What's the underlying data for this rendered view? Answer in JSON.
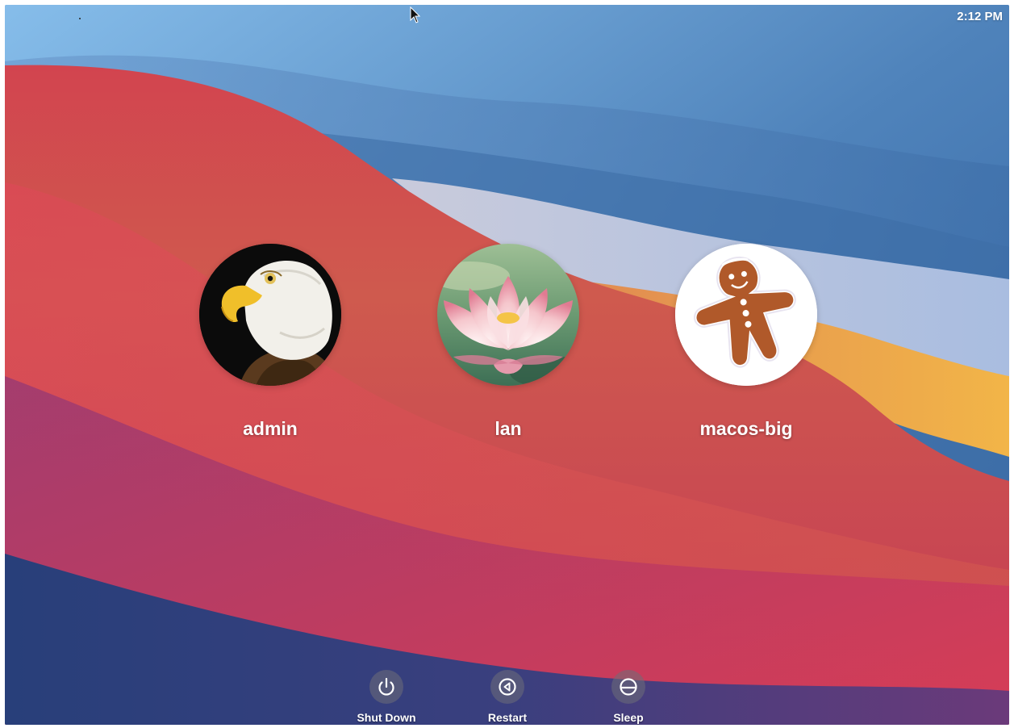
{
  "menubar": {
    "time": "2:12 PM"
  },
  "users": [
    {
      "name": "admin",
      "avatar_icon": "eagle-avatar-icon"
    },
    {
      "name": "lan",
      "avatar_icon": "lotus-flower-avatar-icon"
    },
    {
      "name": "macos-big",
      "avatar_icon": "gingerbread-man-avatar-icon"
    }
  ],
  "power_controls": {
    "shutdown_label": "Shut Down",
    "restart_label": "Restart",
    "sleep_label": "Sleep"
  },
  "colors": {
    "sky_blue": "#4a7ab3",
    "wave_red": "#d9414f",
    "wave_orange": "#e8754d",
    "wave_purple": "#8a3a78"
  }
}
